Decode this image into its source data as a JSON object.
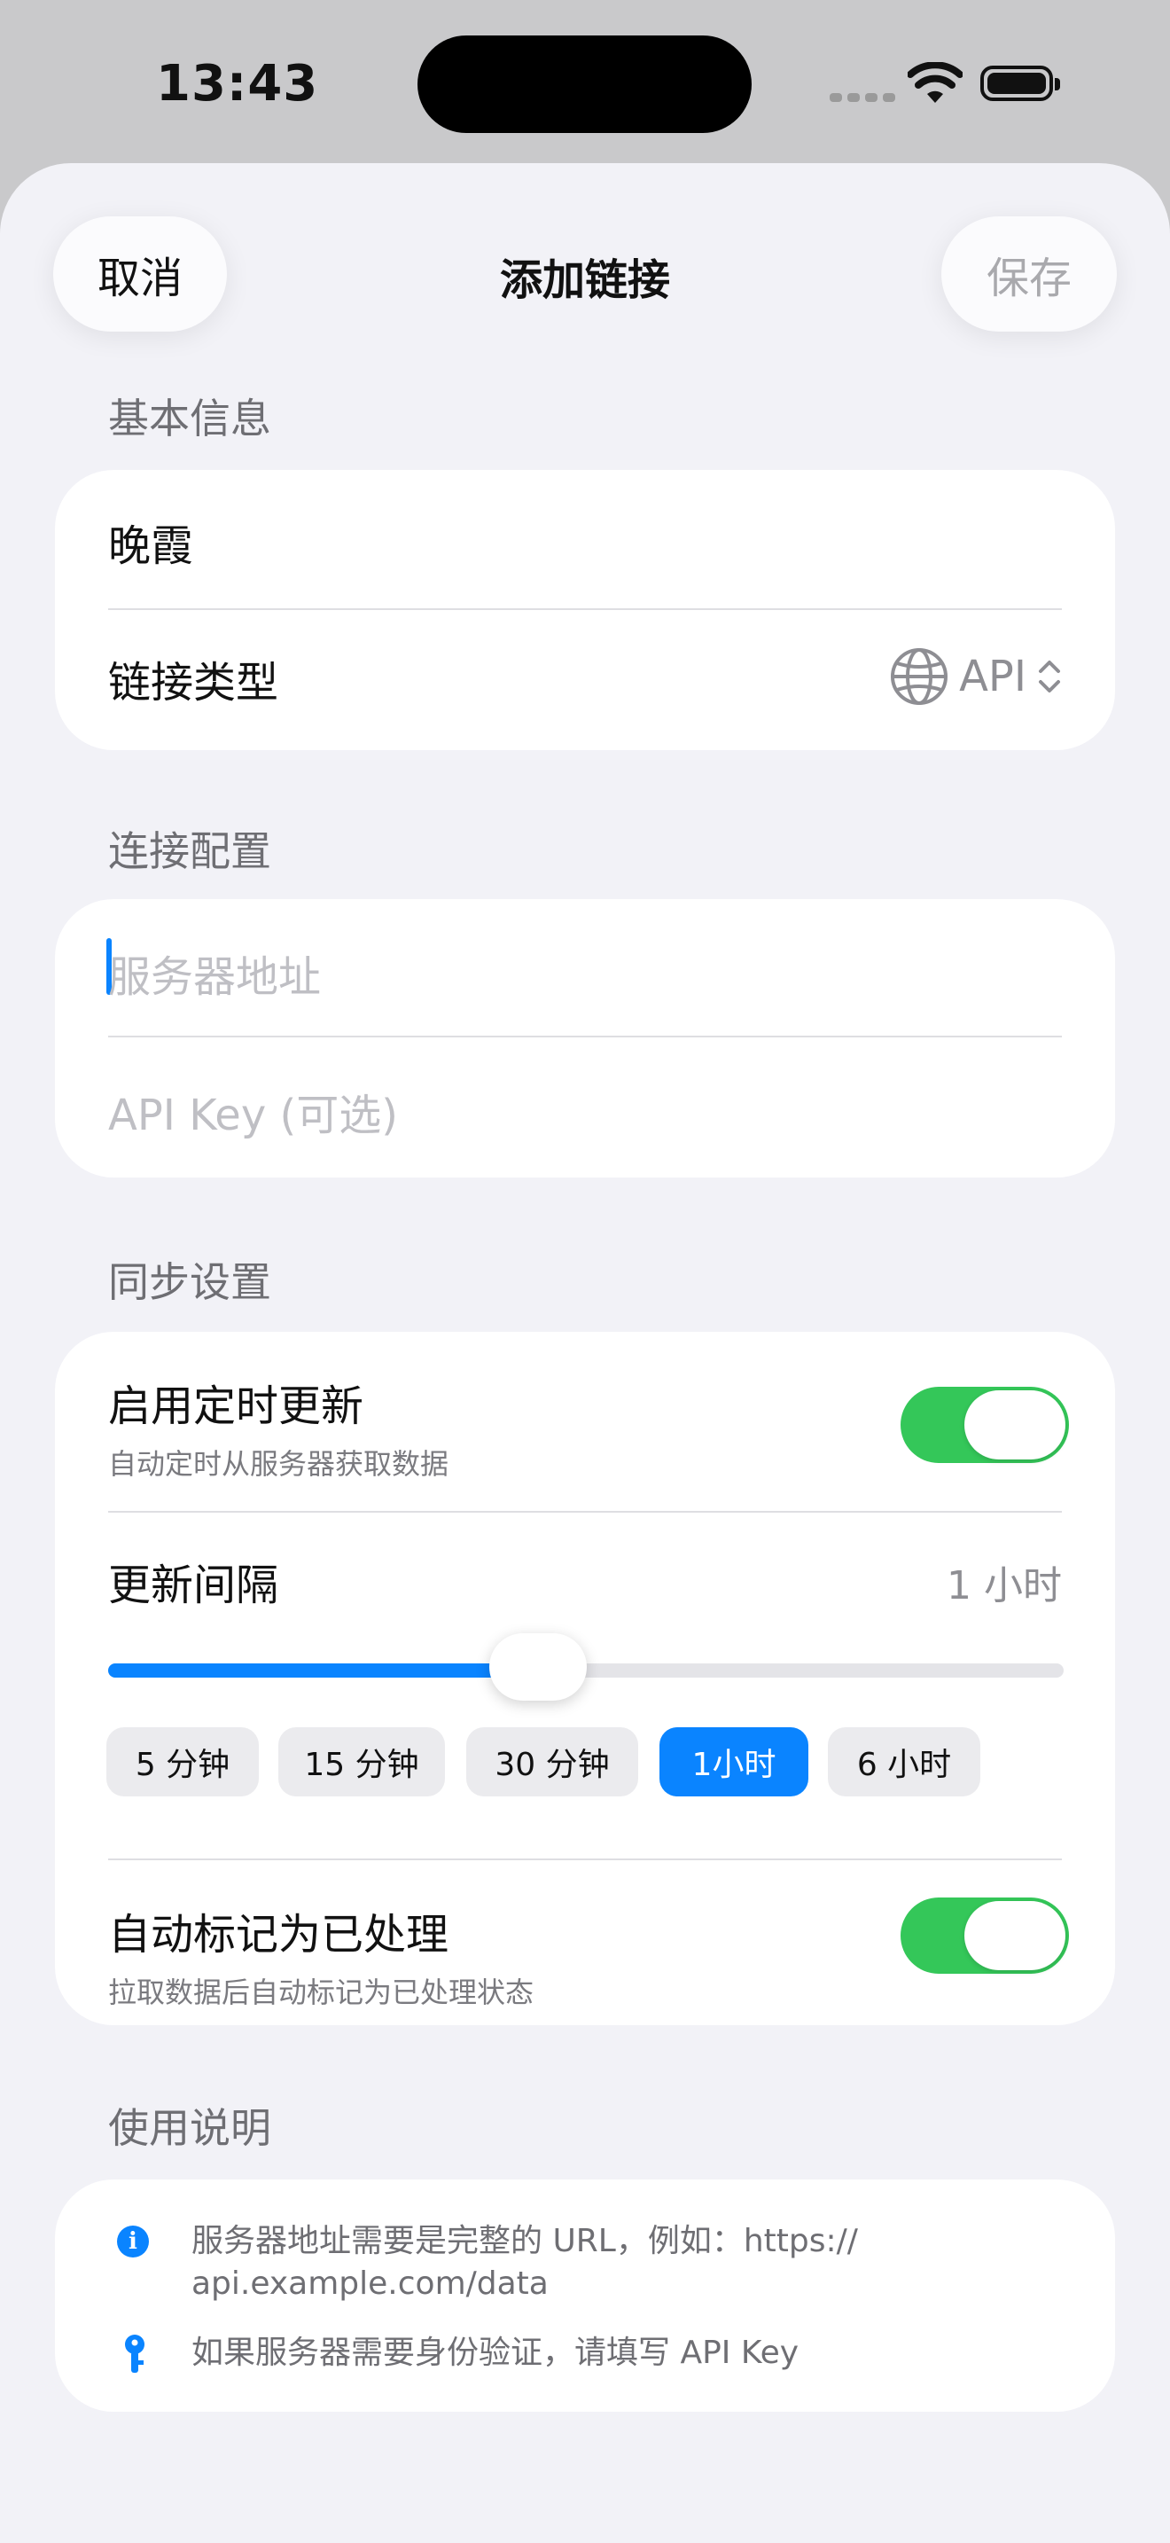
{
  "status_bar": {
    "time": "13:43"
  },
  "nav": {
    "cancel_label": "取消",
    "title": "添加链接",
    "save_label": "保存"
  },
  "basic_info": {
    "header": "基本信息",
    "name_value": "晚霞",
    "link_type_label": "链接类型",
    "link_type_value": "API",
    "link_type_icon": "globe-icon"
  },
  "connection": {
    "header": "连接配置",
    "server_placeholder": "服务器地址",
    "api_key_placeholder": "API Key (可选)"
  },
  "sync": {
    "header": "同步设置",
    "scheduled_update_label": "启用定时更新",
    "scheduled_update_desc": "自动定时从服务器获取数据",
    "scheduled_update_on": true,
    "interval_label": "更新间隔",
    "interval_value": "1 小时",
    "slider_fraction": 0.45,
    "interval_options": [
      "5 分钟",
      "15 分钟",
      "30 分钟",
      "1小时",
      "6 小时"
    ],
    "selected_option": "1小时",
    "auto_mark_label": "自动标记为已处理",
    "auto_mark_desc": "拉取数据后自动标记为已处理状态",
    "auto_mark_on": true
  },
  "usage": {
    "header": "使用说明",
    "tip1_line1": "服务器地址需要是完整的 URL，例如：https://",
    "tip1_line2": "api.example.com/data",
    "tip2": "如果服务器需要身份验证，请填写 API Key",
    "tip1_icon": "info-icon",
    "tip2_icon": "key-icon"
  },
  "colors": {
    "accent": "#0a84ff",
    "toggle_on": "#34c759",
    "background": "#f2f2f7"
  }
}
